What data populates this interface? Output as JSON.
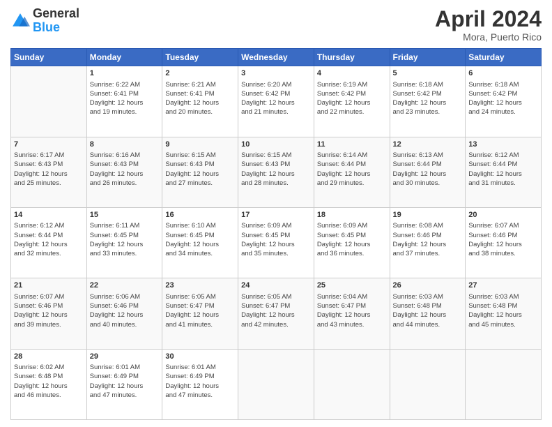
{
  "header": {
    "logo_line1": "General",
    "logo_line2": "Blue",
    "title": "April 2024",
    "subtitle": "Mora, Puerto Rico"
  },
  "calendar": {
    "days_of_week": [
      "Sunday",
      "Monday",
      "Tuesday",
      "Wednesday",
      "Thursday",
      "Friday",
      "Saturday"
    ],
    "weeks": [
      [
        {
          "num": "",
          "info": ""
        },
        {
          "num": "1",
          "info": "Sunrise: 6:22 AM\nSunset: 6:41 PM\nDaylight: 12 hours\nand 19 minutes."
        },
        {
          "num": "2",
          "info": "Sunrise: 6:21 AM\nSunset: 6:41 PM\nDaylight: 12 hours\nand 20 minutes."
        },
        {
          "num": "3",
          "info": "Sunrise: 6:20 AM\nSunset: 6:42 PM\nDaylight: 12 hours\nand 21 minutes."
        },
        {
          "num": "4",
          "info": "Sunrise: 6:19 AM\nSunset: 6:42 PM\nDaylight: 12 hours\nand 22 minutes."
        },
        {
          "num": "5",
          "info": "Sunrise: 6:18 AM\nSunset: 6:42 PM\nDaylight: 12 hours\nand 23 minutes."
        },
        {
          "num": "6",
          "info": "Sunrise: 6:18 AM\nSunset: 6:42 PM\nDaylight: 12 hours\nand 24 minutes."
        }
      ],
      [
        {
          "num": "7",
          "info": "Sunrise: 6:17 AM\nSunset: 6:43 PM\nDaylight: 12 hours\nand 25 minutes."
        },
        {
          "num": "8",
          "info": "Sunrise: 6:16 AM\nSunset: 6:43 PM\nDaylight: 12 hours\nand 26 minutes."
        },
        {
          "num": "9",
          "info": "Sunrise: 6:15 AM\nSunset: 6:43 PM\nDaylight: 12 hours\nand 27 minutes."
        },
        {
          "num": "10",
          "info": "Sunrise: 6:15 AM\nSunset: 6:43 PM\nDaylight: 12 hours\nand 28 minutes."
        },
        {
          "num": "11",
          "info": "Sunrise: 6:14 AM\nSunset: 6:44 PM\nDaylight: 12 hours\nand 29 minutes."
        },
        {
          "num": "12",
          "info": "Sunrise: 6:13 AM\nSunset: 6:44 PM\nDaylight: 12 hours\nand 30 minutes."
        },
        {
          "num": "13",
          "info": "Sunrise: 6:12 AM\nSunset: 6:44 PM\nDaylight: 12 hours\nand 31 minutes."
        }
      ],
      [
        {
          "num": "14",
          "info": "Sunrise: 6:12 AM\nSunset: 6:44 PM\nDaylight: 12 hours\nand 32 minutes."
        },
        {
          "num": "15",
          "info": "Sunrise: 6:11 AM\nSunset: 6:45 PM\nDaylight: 12 hours\nand 33 minutes."
        },
        {
          "num": "16",
          "info": "Sunrise: 6:10 AM\nSunset: 6:45 PM\nDaylight: 12 hours\nand 34 minutes."
        },
        {
          "num": "17",
          "info": "Sunrise: 6:09 AM\nSunset: 6:45 PM\nDaylight: 12 hours\nand 35 minutes."
        },
        {
          "num": "18",
          "info": "Sunrise: 6:09 AM\nSunset: 6:45 PM\nDaylight: 12 hours\nand 36 minutes."
        },
        {
          "num": "19",
          "info": "Sunrise: 6:08 AM\nSunset: 6:46 PM\nDaylight: 12 hours\nand 37 minutes."
        },
        {
          "num": "20",
          "info": "Sunrise: 6:07 AM\nSunset: 6:46 PM\nDaylight: 12 hours\nand 38 minutes."
        }
      ],
      [
        {
          "num": "21",
          "info": "Sunrise: 6:07 AM\nSunset: 6:46 PM\nDaylight: 12 hours\nand 39 minutes."
        },
        {
          "num": "22",
          "info": "Sunrise: 6:06 AM\nSunset: 6:46 PM\nDaylight: 12 hours\nand 40 minutes."
        },
        {
          "num": "23",
          "info": "Sunrise: 6:05 AM\nSunset: 6:47 PM\nDaylight: 12 hours\nand 41 minutes."
        },
        {
          "num": "24",
          "info": "Sunrise: 6:05 AM\nSunset: 6:47 PM\nDaylight: 12 hours\nand 42 minutes."
        },
        {
          "num": "25",
          "info": "Sunrise: 6:04 AM\nSunset: 6:47 PM\nDaylight: 12 hours\nand 43 minutes."
        },
        {
          "num": "26",
          "info": "Sunrise: 6:03 AM\nSunset: 6:48 PM\nDaylight: 12 hours\nand 44 minutes."
        },
        {
          "num": "27",
          "info": "Sunrise: 6:03 AM\nSunset: 6:48 PM\nDaylight: 12 hours\nand 45 minutes."
        }
      ],
      [
        {
          "num": "28",
          "info": "Sunrise: 6:02 AM\nSunset: 6:48 PM\nDaylight: 12 hours\nand 46 minutes."
        },
        {
          "num": "29",
          "info": "Sunrise: 6:01 AM\nSunset: 6:49 PM\nDaylight: 12 hours\nand 47 minutes."
        },
        {
          "num": "30",
          "info": "Sunrise: 6:01 AM\nSunset: 6:49 PM\nDaylight: 12 hours\nand 47 minutes."
        },
        {
          "num": "",
          "info": ""
        },
        {
          "num": "",
          "info": ""
        },
        {
          "num": "",
          "info": ""
        },
        {
          "num": "",
          "info": ""
        }
      ]
    ]
  }
}
